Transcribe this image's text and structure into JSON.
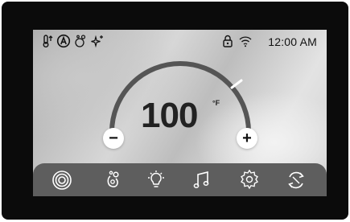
{
  "status_bar": {
    "left_icons": [
      "thermometer-up-icon",
      "auto-mode-icon",
      "bubbles-icon",
      "sparkle-icon"
    ],
    "right_icons": [
      "lock-icon",
      "wifi-icon"
    ],
    "time": "12:00 AM"
  },
  "thermostat": {
    "temperature": "100",
    "unit": "°F",
    "set_level": 0.82
  },
  "controls": {
    "minus_label": "−",
    "plus_label": "+"
  },
  "menu": {
    "items": [
      "jets-icon",
      "bubbles-icon",
      "light-icon",
      "music-icon",
      "settings-icon",
      "cycle-icon"
    ]
  },
  "colors": {
    "bezel": "#0b0b0b",
    "menu_bar": "#5e5e5e",
    "arc": "#555555",
    "arc_marker": "#ffffff"
  }
}
